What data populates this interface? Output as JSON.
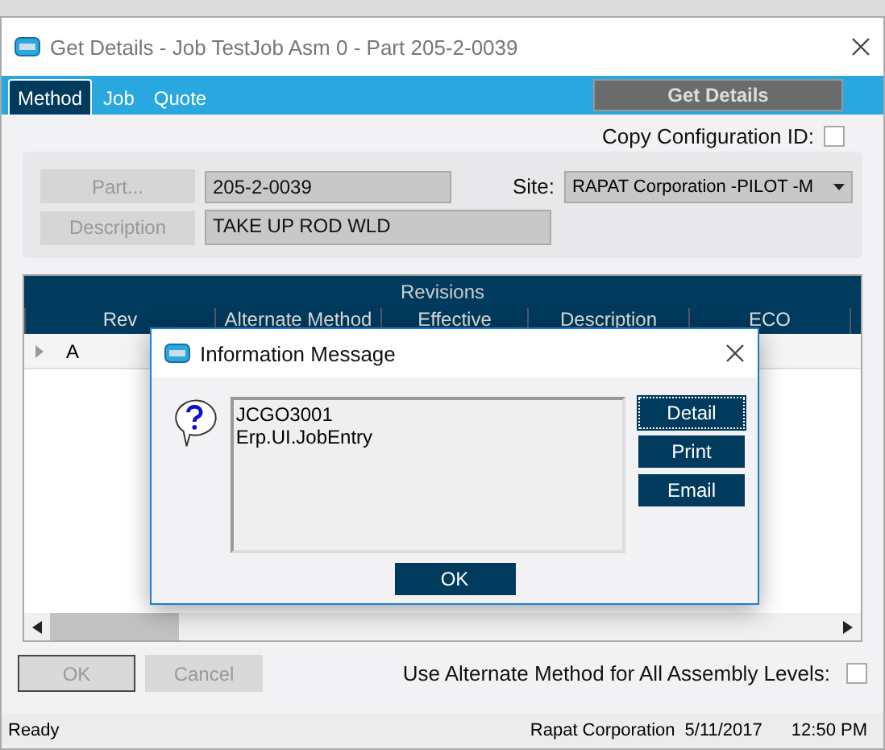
{
  "window": {
    "title": "Get Details - Job TestJob Asm 0 - Part 205-2-0039"
  },
  "tabs": [
    {
      "label": "Method",
      "selected": true
    },
    {
      "label": "Job",
      "selected": false
    },
    {
      "label": "Quote",
      "selected": false
    }
  ],
  "get_details_button": "Get Details",
  "copy_configuration": {
    "label": "Copy Configuration ID:",
    "checked": false
  },
  "part": {
    "button": "Part...",
    "value": "205-2-0039"
  },
  "description": {
    "button": "Description",
    "value": "TAKE UP ROD WLD"
  },
  "site": {
    "label": "Site:",
    "value": "RAPAT Corporation -PILOT -M"
  },
  "revisions": {
    "title": "Revisions",
    "columns": [
      "Rev",
      "Alternate Method",
      "Effective",
      "Description",
      "ECO"
    ],
    "rows": [
      {
        "rev": "A",
        "selected": false
      }
    ]
  },
  "buttons": [
    {
      "label": "OK",
      "disabled": true
    },
    {
      "label": "Cancel",
      "disabled": true
    }
  ],
  "alternate_method": {
    "label": "Use Alternate Method for All Assembly Levels:",
    "checked": false
  },
  "status_bar": {
    "status": "Ready",
    "company": "Rapat Corporation",
    "date": "5/11/2017",
    "time": "12:50 PM"
  },
  "dialog": {
    "title": "Information Message",
    "lines": [
      "JCGO3001",
      "Erp.UI.JobEntry"
    ],
    "side_buttons": [
      "Detail",
      "Print",
      "Email"
    ],
    "ok": "OK"
  }
}
